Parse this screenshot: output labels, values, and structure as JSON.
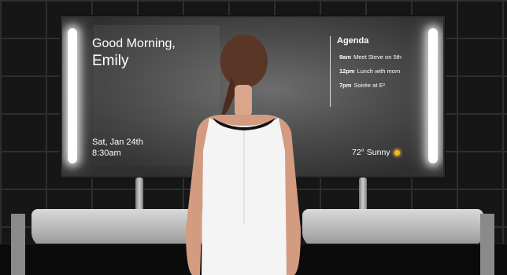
{
  "greeting": {
    "line1": "Good Morning,",
    "line2": "Emily"
  },
  "datetime": {
    "date": "Sat, Jan 24th",
    "time": "8:30am"
  },
  "agenda": {
    "title": "Agenda",
    "items": [
      {
        "time": "9am",
        "text": "Meet Steve on 5th"
      },
      {
        "time": "12pm",
        "text": "Lunch with mom"
      },
      {
        "time": "7pm",
        "text": "Soirée at E²"
      }
    ]
  },
  "weather": {
    "text": "72° Sunny",
    "icon": "sun-icon"
  },
  "colors": {
    "sun": "#f5b72f",
    "text": "#ffffff",
    "tile": "#161616"
  }
}
